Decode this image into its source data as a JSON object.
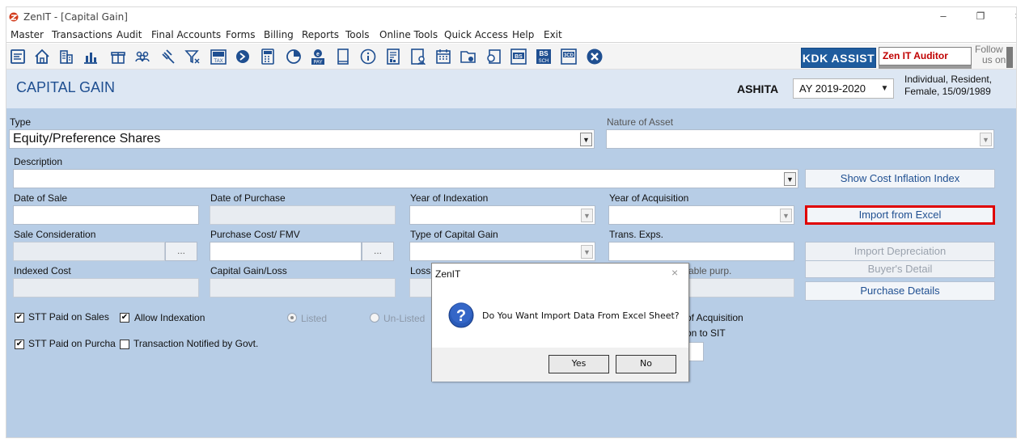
{
  "window": {
    "title": "ZenIT - [Capital Gain]",
    "minimize": "–",
    "maximize": "❐",
    "close": "×"
  },
  "menu": [
    "Master",
    "Transactions",
    "Audit",
    "Final Accounts",
    "Forms",
    "Billing",
    "Reports",
    "Tools",
    "Online Tools",
    "Quick Access",
    "Help",
    "Exit"
  ],
  "toolbar": {
    "icons": [
      "form-icon",
      "home-icon",
      "building-icon",
      "bar-chart-icon",
      "gift-icon",
      "people-icon",
      "gavel-icon",
      "filter-icon",
      "tax-icon",
      "toggle-icon",
      "calculator-icon",
      "pie-chart-icon",
      "e-pay-icon",
      "book-icon",
      "info-icon",
      "document-icon",
      "user-icon",
      "calendar-icon",
      "folder-icon",
      "refresh-icon",
      "bs-icon",
      "bs-sch-icon",
      "3cd-icon",
      "close-circle-icon"
    ],
    "tax_label": "TAX",
    "pay_label": "PAY",
    "bs_label": "BS",
    "sch_label": "SCH",
    "cd3_label": "3CD",
    "kdk_assist": "KDK ASSIST",
    "zen_auditor": "Zen IT Auditor",
    "follow_line1": "Follow",
    "follow_line2": "us on"
  },
  "header": {
    "title": "CAPITAL GAIN",
    "client_name": "ASHITA",
    "assessment_year": "AY 2019-2020",
    "client_info_line1": "Individual, Resident,",
    "client_info_line2": "Female, 15/09/1989"
  },
  "form": {
    "type_label": "Type",
    "type_value": "Equity/Preference Shares",
    "nature_label": "Nature of Asset",
    "nature_value": "",
    "description_label": "Description",
    "description_value": "",
    "date_of_sale_label": "Date of Sale",
    "date_of_purchase_label": "Date of Purchase",
    "year_of_indexation_label": "Year of Indexation",
    "year_of_acquisition_label": "Year of Acquisition",
    "sale_consideration_label": "Sale Consideration",
    "purchase_cost_label": "Purchase Cost/ FMV",
    "type_of_cg_label": "Type of Capital Gain",
    "trans_exps_label": "Trans. Exps.",
    "indexed_cost_label": "Indexed Cost",
    "capital_gain_loss_label": "Capital Gain/Loss",
    "loss_label_partial": "Loss",
    "charitable_label_partial": "ritable  purp.",
    "ellipsis": "...",
    "stt_sales_label": "STT Paid on Sales",
    "allow_indexation_label": "Allow Indexation",
    "listed_label": "Listed",
    "unlisted_label": "Un-Listed",
    "stt_purchase_label": "STT Paid on Purcha",
    "notified_label": "Transaction Notified by Govt.",
    "of_acquisition_partial": "of Acquisition",
    "on_to_sit_partial": "on to SIT",
    "checkbox_mark": "✔"
  },
  "side_buttons": {
    "show_cii": "Show Cost Inflation Index",
    "import_excel": "Import from Excel",
    "import_depreciation": "Import Depreciation",
    "buyers_detail": "Buyer's Detail",
    "purchase_details": "Purchase Details"
  },
  "dialog": {
    "title": "ZenIT",
    "close": "×",
    "message": "Do You Want Import Data From Excel Sheet?",
    "yes": "Yes",
    "no": "No"
  },
  "colors": {
    "header_bg": "#dde7f3",
    "form_bg": "#b7cde6",
    "title_blue": "#1f4f91",
    "highlight_red": "#e00000",
    "kdk_blue": "#1f5c9e"
  }
}
